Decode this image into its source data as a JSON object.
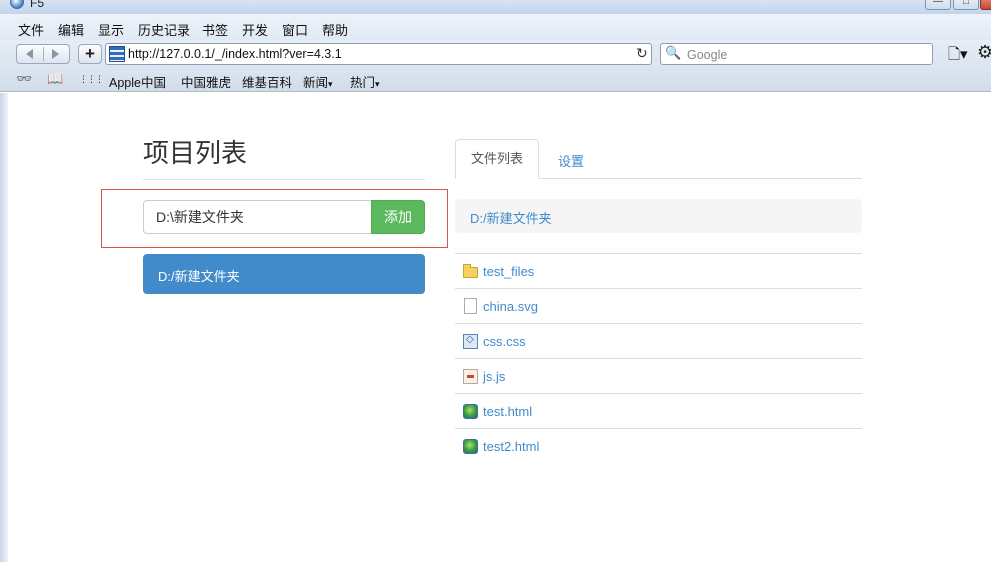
{
  "window": {
    "title": "F5",
    "min_glyph": "—",
    "max_glyph": "□",
    "close_glyph": "✕"
  },
  "menu": [
    "文件",
    "编辑",
    "显示",
    "历史记录",
    "书签",
    "开发",
    "窗口",
    "帮助"
  ],
  "toolbar": {
    "add_glyph": "+",
    "url": "http://127.0.0.1/_/index.html?ver=4.3.1",
    "reload_glyph": "↻",
    "search_placeholder": "Google",
    "search_glyph": "🔍",
    "page_menu_glyph": "🗋▾",
    "settings_glyph": "⚙"
  },
  "bookmarks": {
    "reader_glyph": "👓",
    "book_glyph": "📖",
    "grid_glyph": "⋮⋮⋮",
    "items": [
      "Apple中国",
      "中国雅虎",
      "维基百科",
      "新闻",
      "热门"
    ],
    "dropdown_caret": "▾"
  },
  "page": {
    "title": "项目列表",
    "input_value": "D:\\新建文件夹",
    "add_button": "添加",
    "project_item": "D:/新建文件夹",
    "tabs": {
      "files": "文件列表",
      "settings": "设置"
    },
    "current_path": "D:/新建文件夹",
    "files": [
      {
        "name": "test_files",
        "icon": "folder-icon"
      },
      {
        "name": "china.svg",
        "icon": "document-icon"
      },
      {
        "name": "css.css",
        "icon": "css-file-icon"
      },
      {
        "name": "js.js",
        "icon": "js-file-icon"
      },
      {
        "name": "test.html",
        "icon": "html-file-icon"
      },
      {
        "name": "test2.html",
        "icon": "html-file-icon"
      }
    ]
  },
  "colors": {
    "primary": "#428bca",
    "success": "#5cb85c",
    "highlight_border": "#d9534f"
  }
}
